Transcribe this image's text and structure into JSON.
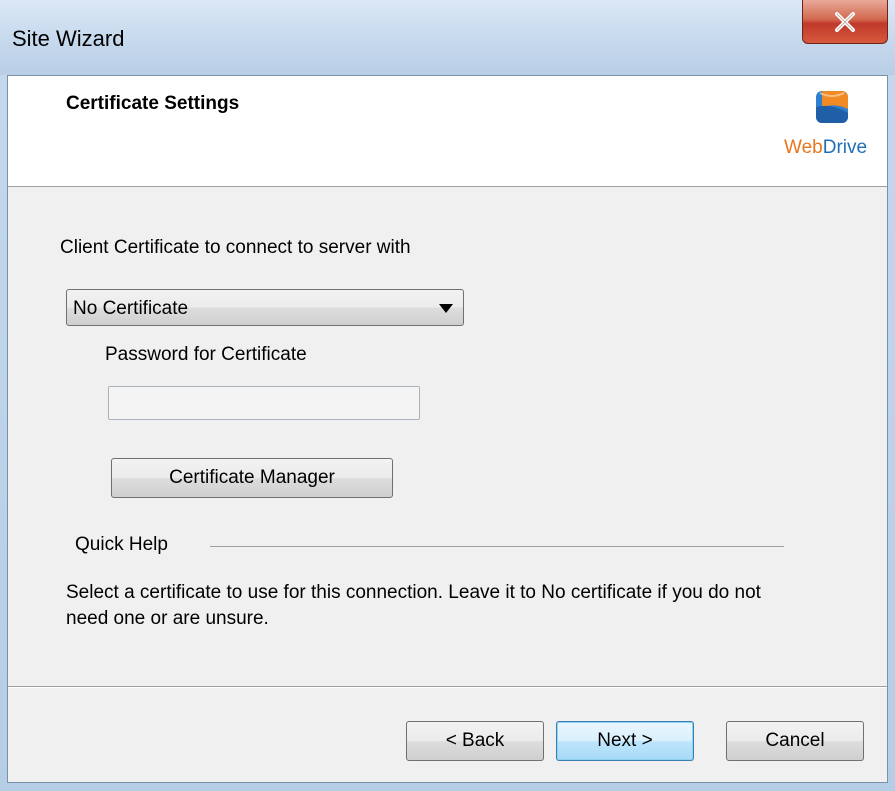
{
  "window": {
    "title": "Site Wizard",
    "close_symbol": "x"
  },
  "header": {
    "title": "Certificate Settings",
    "logo": {
      "icon": "webdrive-logo-icon",
      "text_web": "Web",
      "text_drive": "Drive"
    }
  },
  "certificate": {
    "label": "Client Certificate to connect to server with",
    "selected": "No Certificate",
    "password_label": "Password for Certificate",
    "password_value": "",
    "manager_button": "Certificate Manager"
  },
  "quick_help": {
    "title": "Quick Help",
    "text": "Select a certificate to use for this connection.  Leave it to No certificate if you do not need one or are unsure."
  },
  "buttons": {
    "back": "< Back",
    "next": "Next >",
    "cancel": "Cancel"
  },
  "colors": {
    "close_red": "#c0392b",
    "logo_orange": "#e8761d",
    "logo_blue": "#1f6fb7"
  }
}
